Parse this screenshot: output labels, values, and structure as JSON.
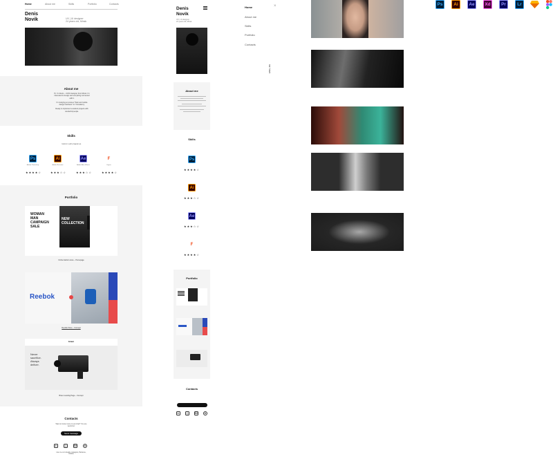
{
  "desktop": {
    "nav": [
      "Home",
      "About me",
      "Skills",
      "Portfolio",
      "Contacts"
    ],
    "name_first": "Denis",
    "name_last": "Novik",
    "tagline_1": "UX | UI designer",
    "tagline_2": "24 years old, Minsk",
    "about_title": "About me",
    "about_p1": "Hi, I'm Denis – UX/UI designer from Minsk. I'm interested in design and everything connected with it.",
    "about_p2": "I'm studying at courses \"Web and mobile design interfaces\" in IT-Academy.",
    "about_p3": "Ready to implement excellent projects with wonderful people.",
    "skills_title": "Skills",
    "skills_sub": "I work in such program as",
    "skills": [
      {
        "abbr": "Ps",
        "name": "Adobe Photoshop",
        "stars": "★★★★☆",
        "bg": "#001e36",
        "fg": "#31a8ff"
      },
      {
        "abbr": "Ai",
        "name": "Adobe Illustrator",
        "stars": "★★★☆☆",
        "bg": "#330000",
        "fg": "#ff9a00"
      },
      {
        "abbr": "Ae",
        "name": "Adobe After Effects",
        "stars": "★★★☆☆",
        "bg": "#00005b",
        "fg": "#9999ff"
      },
      {
        "abbr": "F",
        "name": "Figma",
        "stars": "★★★★☆",
        "bg": "#ffffff",
        "fg": "#f24e1e"
      }
    ],
    "portfolio_title": "Portfolio",
    "p1_text": [
      "WOMAN",
      "MAN",
      "CAMPAIGN",
      "SALE"
    ],
    "p1_col": "NEW COLLECTION",
    "p1_caption": "Online fashion store – Homepage",
    "p2_brand": "Reebok",
    "p2_caption": "Reebok Store – Concept",
    "p3_text": [
      "Never",
      "sacrifice.",
      "Always",
      "deliver."
    ],
    "p3_logo": "braun",
    "p3_caption": "Braun Landing Page – Concept",
    "contacts_title": "Contacts",
    "contacts_sub": "Want to know more or just chat? You are welcome!",
    "contacts_btn": "Send message",
    "contacts_foot": "Like me on LinkedIn, Instagram, Behance, Dribble"
  },
  "mobile": {
    "name_first": "Denis",
    "name_last": "Novik",
    "tagline_1": "UX | UI designer",
    "tagline_2": "24 years old, Minsk",
    "about_title": "About me",
    "skills_title": "Skills",
    "portfolio_title": "Portfolio",
    "contacts_title": "Contacts",
    "menu": [
      "Home",
      "About me",
      "Skills",
      "Portfolio",
      "Contacts"
    ],
    "close": "×",
    "vertical": "ENG | RU"
  },
  "assets": {
    "icons": [
      {
        "abbr": "Ps",
        "bg": "#001e36",
        "fg": "#31a8ff"
      },
      {
        "abbr": "Ai",
        "bg": "#330000",
        "fg": "#ff9a00"
      },
      {
        "abbr": "Ae",
        "bg": "#00005b",
        "fg": "#9999ff"
      },
      {
        "abbr": "Xd",
        "bg": "#470137",
        "fg": "#ff61f6"
      },
      {
        "abbr": "Pr",
        "bg": "#00005b",
        "fg": "#9999ff"
      },
      {
        "abbr": "Lr",
        "bg": "#001e36",
        "fg": "#31a8ff"
      }
    ]
  }
}
